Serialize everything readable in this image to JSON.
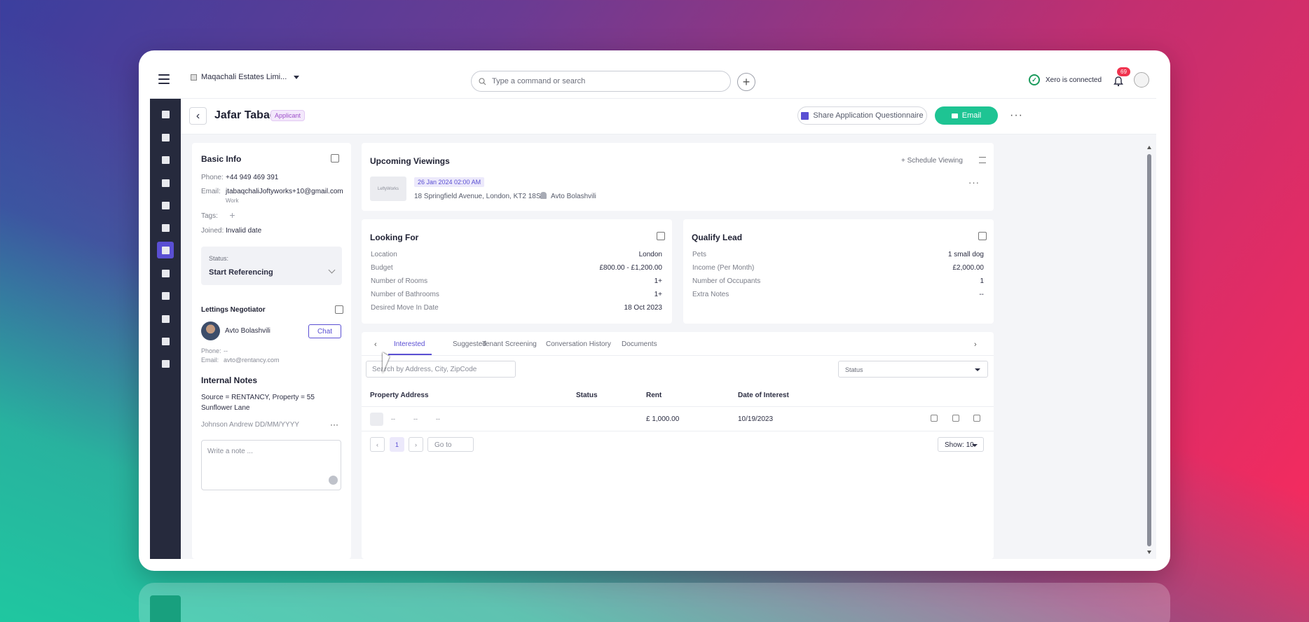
{
  "topbar": {
    "company": "Maqachali Estates Limi...",
    "search_placeholder": "Type a command or search",
    "xero_status": "Xero is connected",
    "notification_count": "69"
  },
  "header": {
    "title": "Jafar Tabaq",
    "tag": "Applicant",
    "share_label": "Share Application Questionnaire",
    "email_label": "Email"
  },
  "basic_info": {
    "title": "Basic Info",
    "phone_label": "Phone:",
    "phone": "+44 949 469 391",
    "email_label": "Email:",
    "email": "jtabaqchaliJoftyworks+10@gmail.com",
    "email_type": "Work",
    "tags_label": "Tags:",
    "joined_label": "Joined:",
    "joined": "Invalid date",
    "status_label": "Status:",
    "status": "Start Referencing"
  },
  "negotiator": {
    "title": "Lettings Negotiator",
    "name": "Avto Bolashvili",
    "chat_label": "Chat",
    "phone_label": "Phone:",
    "phone": "--",
    "email_label": "Email:",
    "email": "avto@rentancy.com"
  },
  "notes": {
    "title": "Internal Notes",
    "text": "Source = RENTANCY, Property = 55 Sunflower Lane",
    "meta": "Johnson Andrew DD/MM/YYYY",
    "placeholder": "Write a note ..."
  },
  "viewings": {
    "title": "Upcoming Viewings",
    "schedule_label": "+ Schedule Viewing",
    "thumb_text": "LeftyWorks",
    "date": "26 Jan 2024 02:00 AM",
    "address": "18 Springfield Avenue, London, KT2 18SA",
    "agent": "Avto Bolashvili"
  },
  "looking_for": {
    "title": "Looking For",
    "rows": [
      {
        "label": "Location",
        "value": "London"
      },
      {
        "label": "Budget",
        "value": "£800.00 - £1,200.00"
      },
      {
        "label": "Number of Rooms",
        "value": "1+"
      },
      {
        "label": "Number of Bathrooms",
        "value": "1+"
      },
      {
        "label": "Desired Move In Date",
        "value": "18 Oct 2023"
      }
    ]
  },
  "qualify_lead": {
    "title": "Qualify Lead",
    "rows": [
      {
        "label": "Pets",
        "value": "1 small dog"
      },
      {
        "label": "Income (Per Month)",
        "value": "£2,000.00"
      },
      {
        "label": "Number of Occupants",
        "value": "1"
      },
      {
        "label": "Extra Notes",
        "value": "--"
      }
    ]
  },
  "tabs": [
    "Interested",
    "Suggested",
    "Tenant Screening",
    "Conversation History",
    "Documents"
  ],
  "table": {
    "search_placeholder": "Search by Address, City, ZipCode",
    "status_placeholder": "Status",
    "headers": [
      "Property Address",
      "Status",
      "Rent",
      "Date of Interest"
    ],
    "rows": [
      {
        "beds": "--",
        "baths": "--",
        "area": "--",
        "rent": "£ 1,000.00",
        "date": "10/19/2023"
      }
    ],
    "page": "1",
    "goto_placeholder": "Go to",
    "show_label": "Show: 10"
  }
}
